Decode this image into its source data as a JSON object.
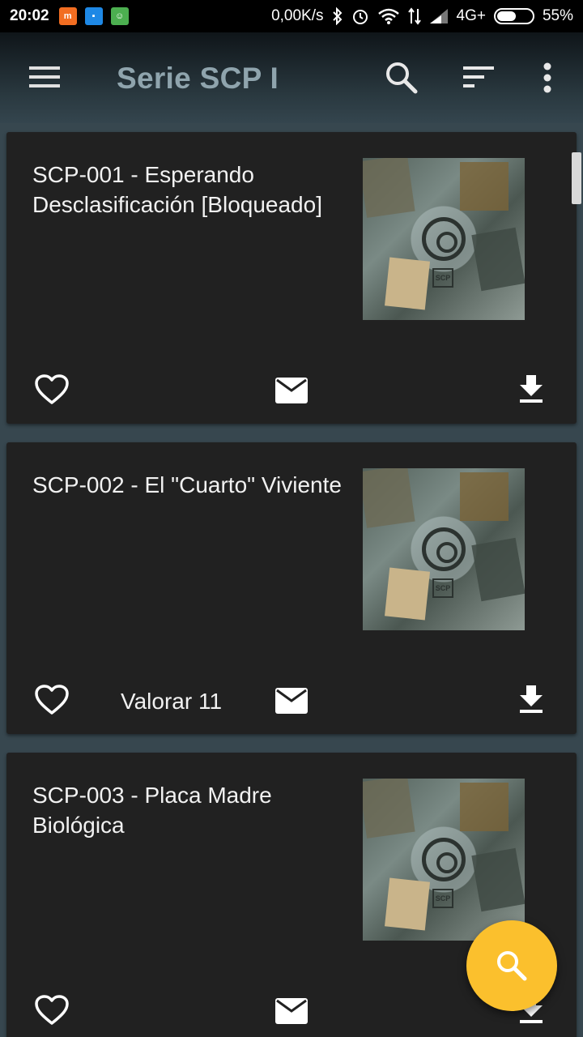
{
  "status_bar": {
    "time": "20:02",
    "network_speed": "0,00K/s",
    "network_type": "4G+",
    "battery": "55%",
    "battery_level": 0.55
  },
  "app_bar": {
    "title": "Serie SCP I",
    "icons": [
      "menu-icon",
      "search-icon",
      "sort-icon",
      "more-vert-icon"
    ]
  },
  "cards": [
    {
      "title": "SCP-001 - Esperando Desclasificación [Bloqueado]",
      "rating_label": ""
    },
    {
      "title": "SCP-002 - El \"Cuarto\" Viviente",
      "rating_label": "Valorar 11"
    },
    {
      "title": "SCP-003 - Placa Madre Biológica",
      "rating_label": ""
    }
  ],
  "thumbnail_tag": "SCP",
  "colors": {
    "background": "#37474f",
    "card": "#212121",
    "fab": "#fbc02d",
    "title": "#8fa4ad"
  }
}
